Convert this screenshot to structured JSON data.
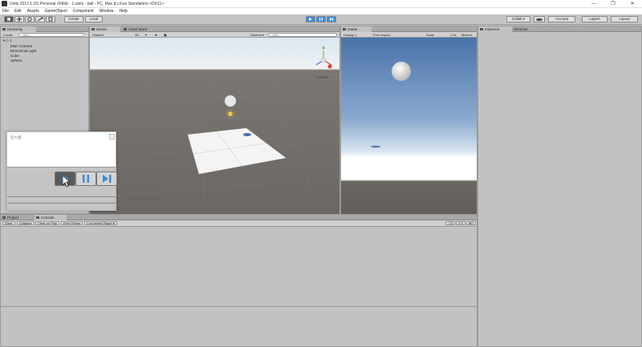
{
  "window": {
    "title": "Unity 2017.1.1f1 Personal (64bit) - 1.unity - ball - PC, Mac & Linux Standalone <DX11>",
    "controls": [
      "—",
      "❐",
      "✕"
    ]
  },
  "menu": [
    "File",
    "Edit",
    "Assets",
    "GameObject",
    "Component",
    "Window",
    "Help"
  ],
  "toolbar": {
    "tools": [
      "hand",
      "move",
      "rotate",
      "scale",
      "rect"
    ],
    "center_label": "Center",
    "local_label": "Local",
    "collab_label": "Collab ▾",
    "account_label": "Account",
    "layers_label": "Layers",
    "layout_label": "Layout"
  },
  "hierarchy": {
    "tab": "Hierarchy",
    "create": "Create",
    "search_placeholder": "▾All",
    "scene": "1",
    "items": [
      "Main Camera",
      "Directional Light",
      "Cube",
      "Sphere"
    ]
  },
  "scene": {
    "tab": "Scene",
    "asset_store_tab": "Asset Store",
    "shaded": "Shaded",
    "mode_2d": "2D",
    "gizmos": "Gizmos ▾",
    "search_placeholder": "▾All",
    "persp_label": "< Persp"
  },
  "game": {
    "tab": "Game",
    "display": "Display 1",
    "aspect": "Free Aspect",
    "scale_label": "Scale",
    "scale_value": "1.0x",
    "maximize": "Maximi"
  },
  "inspector": {
    "tab": "Inspector",
    "services_tab": "Services"
  },
  "floating_window": {
    "title": "名大賞"
  },
  "bottom": {
    "project_tab": "Project",
    "console_tab": "Console",
    "buttons": [
      "Clear",
      "Collapse",
      "Clear on Play",
      "Error Pause",
      "Connected Player ▾"
    ],
    "counts": [
      "0",
      "0",
      "0"
    ]
  }
}
